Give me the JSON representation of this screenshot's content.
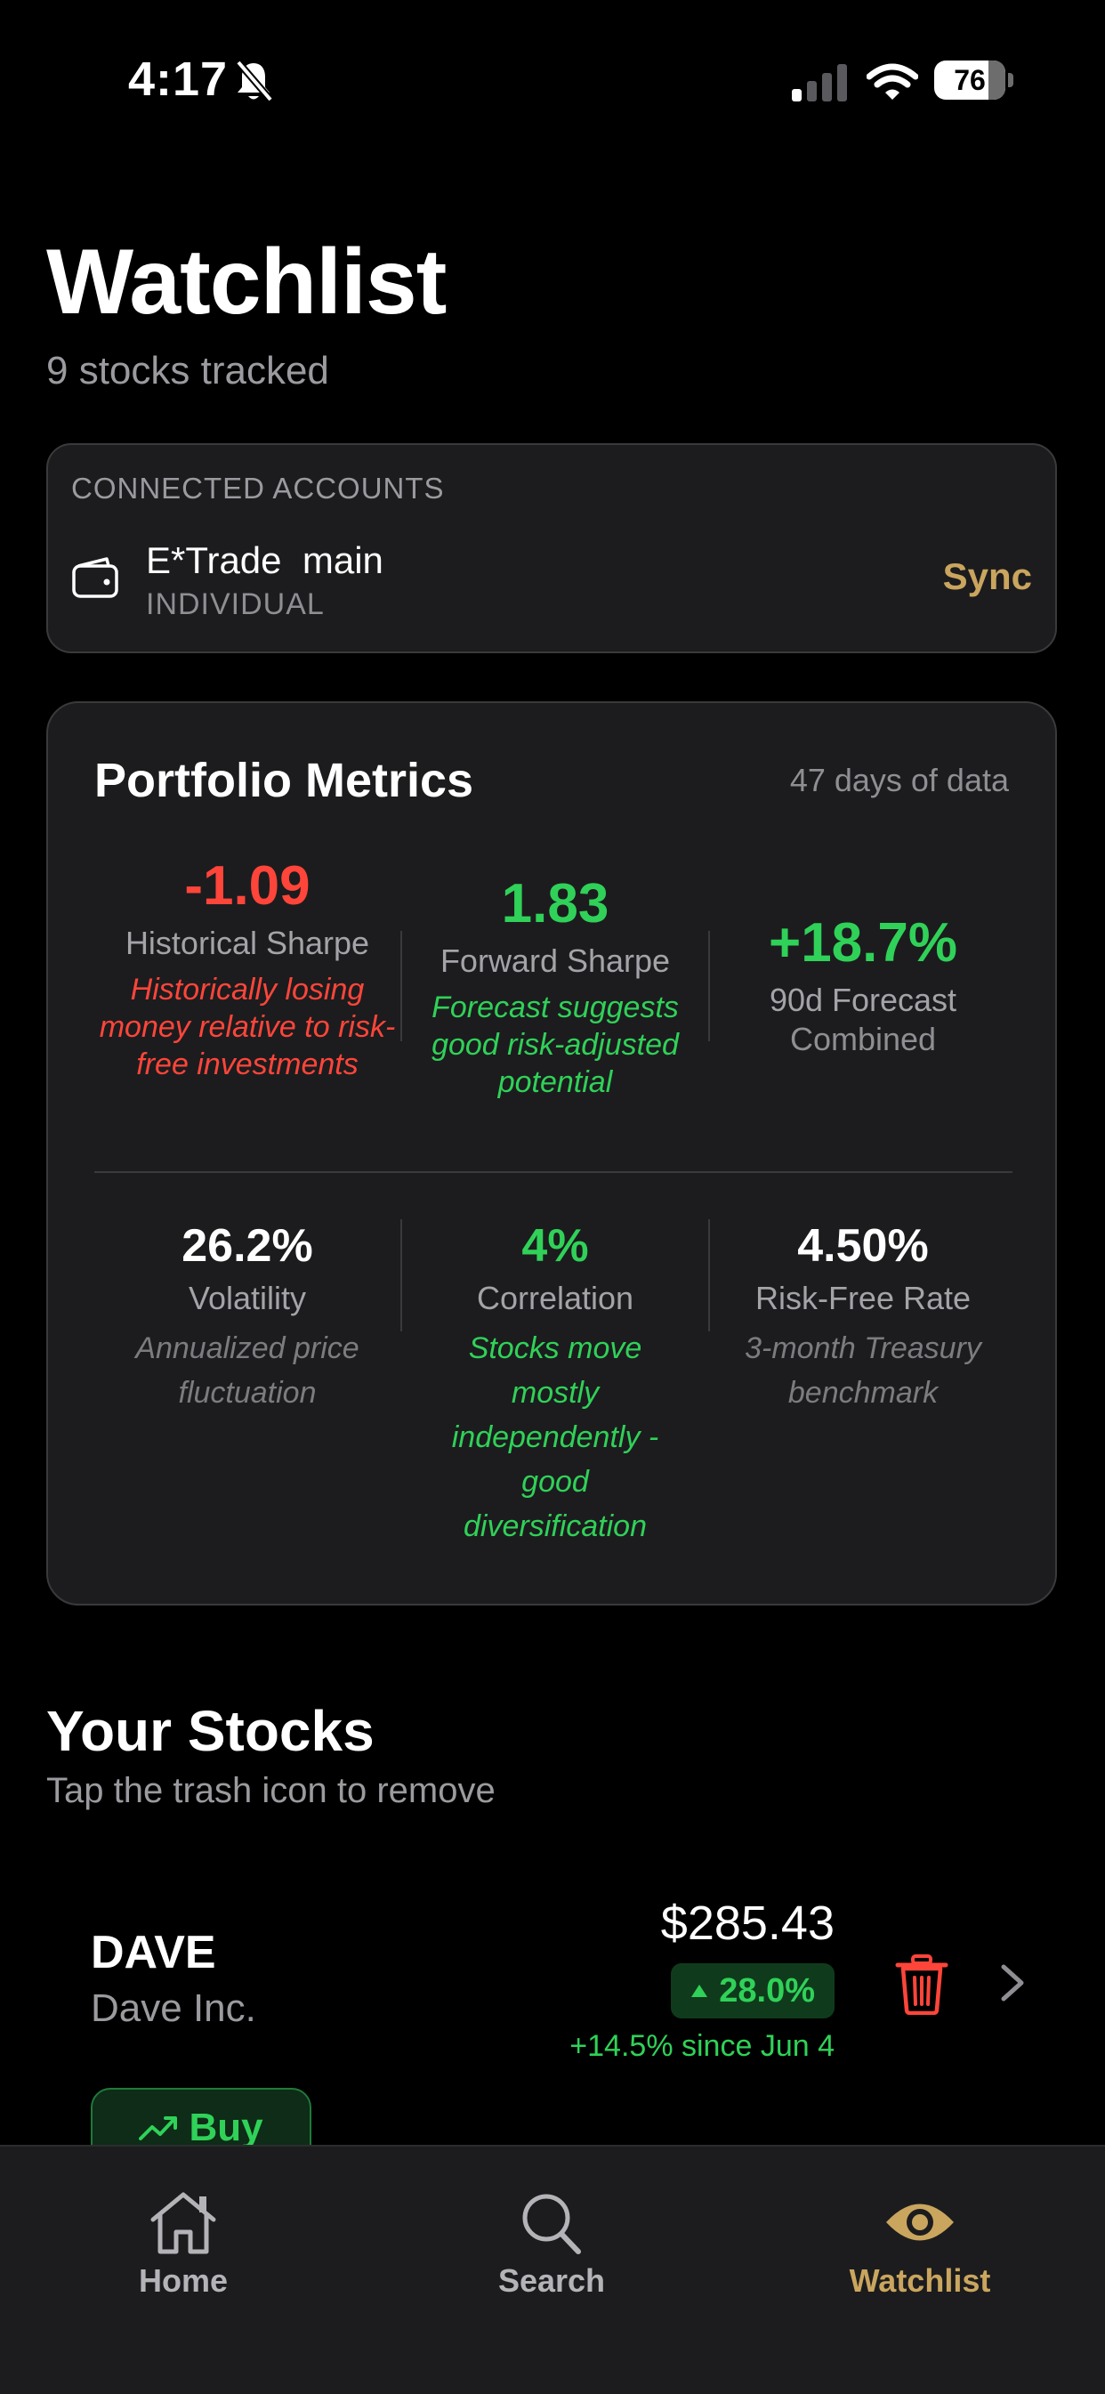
{
  "status": {
    "time": "4:17",
    "battery": "76",
    "battery_level": 0.76
  },
  "header": {
    "title": "Watchlist",
    "subtitle": "9 stocks tracked"
  },
  "accounts": {
    "section_label": "CONNECTED ACCOUNTS",
    "items": [
      {
        "name": "E*Trade  main",
        "type": "INDIVIDUAL",
        "action_label": "Sync"
      }
    ]
  },
  "metrics": {
    "title": "Portfolio Metrics",
    "meta": "47 days of data",
    "row1": [
      {
        "value": "-1.09",
        "label": "Historical Sharpe",
        "desc": "Historically losing money relative to risk-free investments"
      },
      {
        "value": "1.83",
        "label": "Forward Sharpe",
        "desc": "Forecast suggests good risk-adjusted potential"
      },
      {
        "value": "+18.7%",
        "label": "90d Forecast",
        "desc": "Combined"
      }
    ],
    "row2": [
      {
        "value": "26.2%",
        "label": "Volatility",
        "desc": "Annualized price fluctuation"
      },
      {
        "value": "4%",
        "label": "Correlation",
        "desc": "Stocks move mostly independently - good diversification"
      },
      {
        "value": "4.50%",
        "label": "Risk-Free Rate",
        "desc": "3-month Treasury benchmark"
      }
    ]
  },
  "stocks": {
    "title": "Your Stocks",
    "subtitle": "Tap the trash icon to remove",
    "items": [
      {
        "ticker": "DAVE",
        "company": "Dave Inc.",
        "price": "$285.43",
        "change": "28.0%",
        "since": "+14.5% since Jun 4",
        "buy_label": "Buy"
      }
    ]
  },
  "tabs": [
    {
      "label": "Home",
      "icon": "home-icon"
    },
    {
      "label": "Search",
      "icon": "search-icon"
    },
    {
      "label": "Watchlist",
      "icon": "eye-icon",
      "active": true
    }
  ],
  "colors": {
    "accent": "#c9a55e",
    "negative": "#ff453a",
    "positive": "#30d158",
    "card": "#1c1c1e"
  }
}
